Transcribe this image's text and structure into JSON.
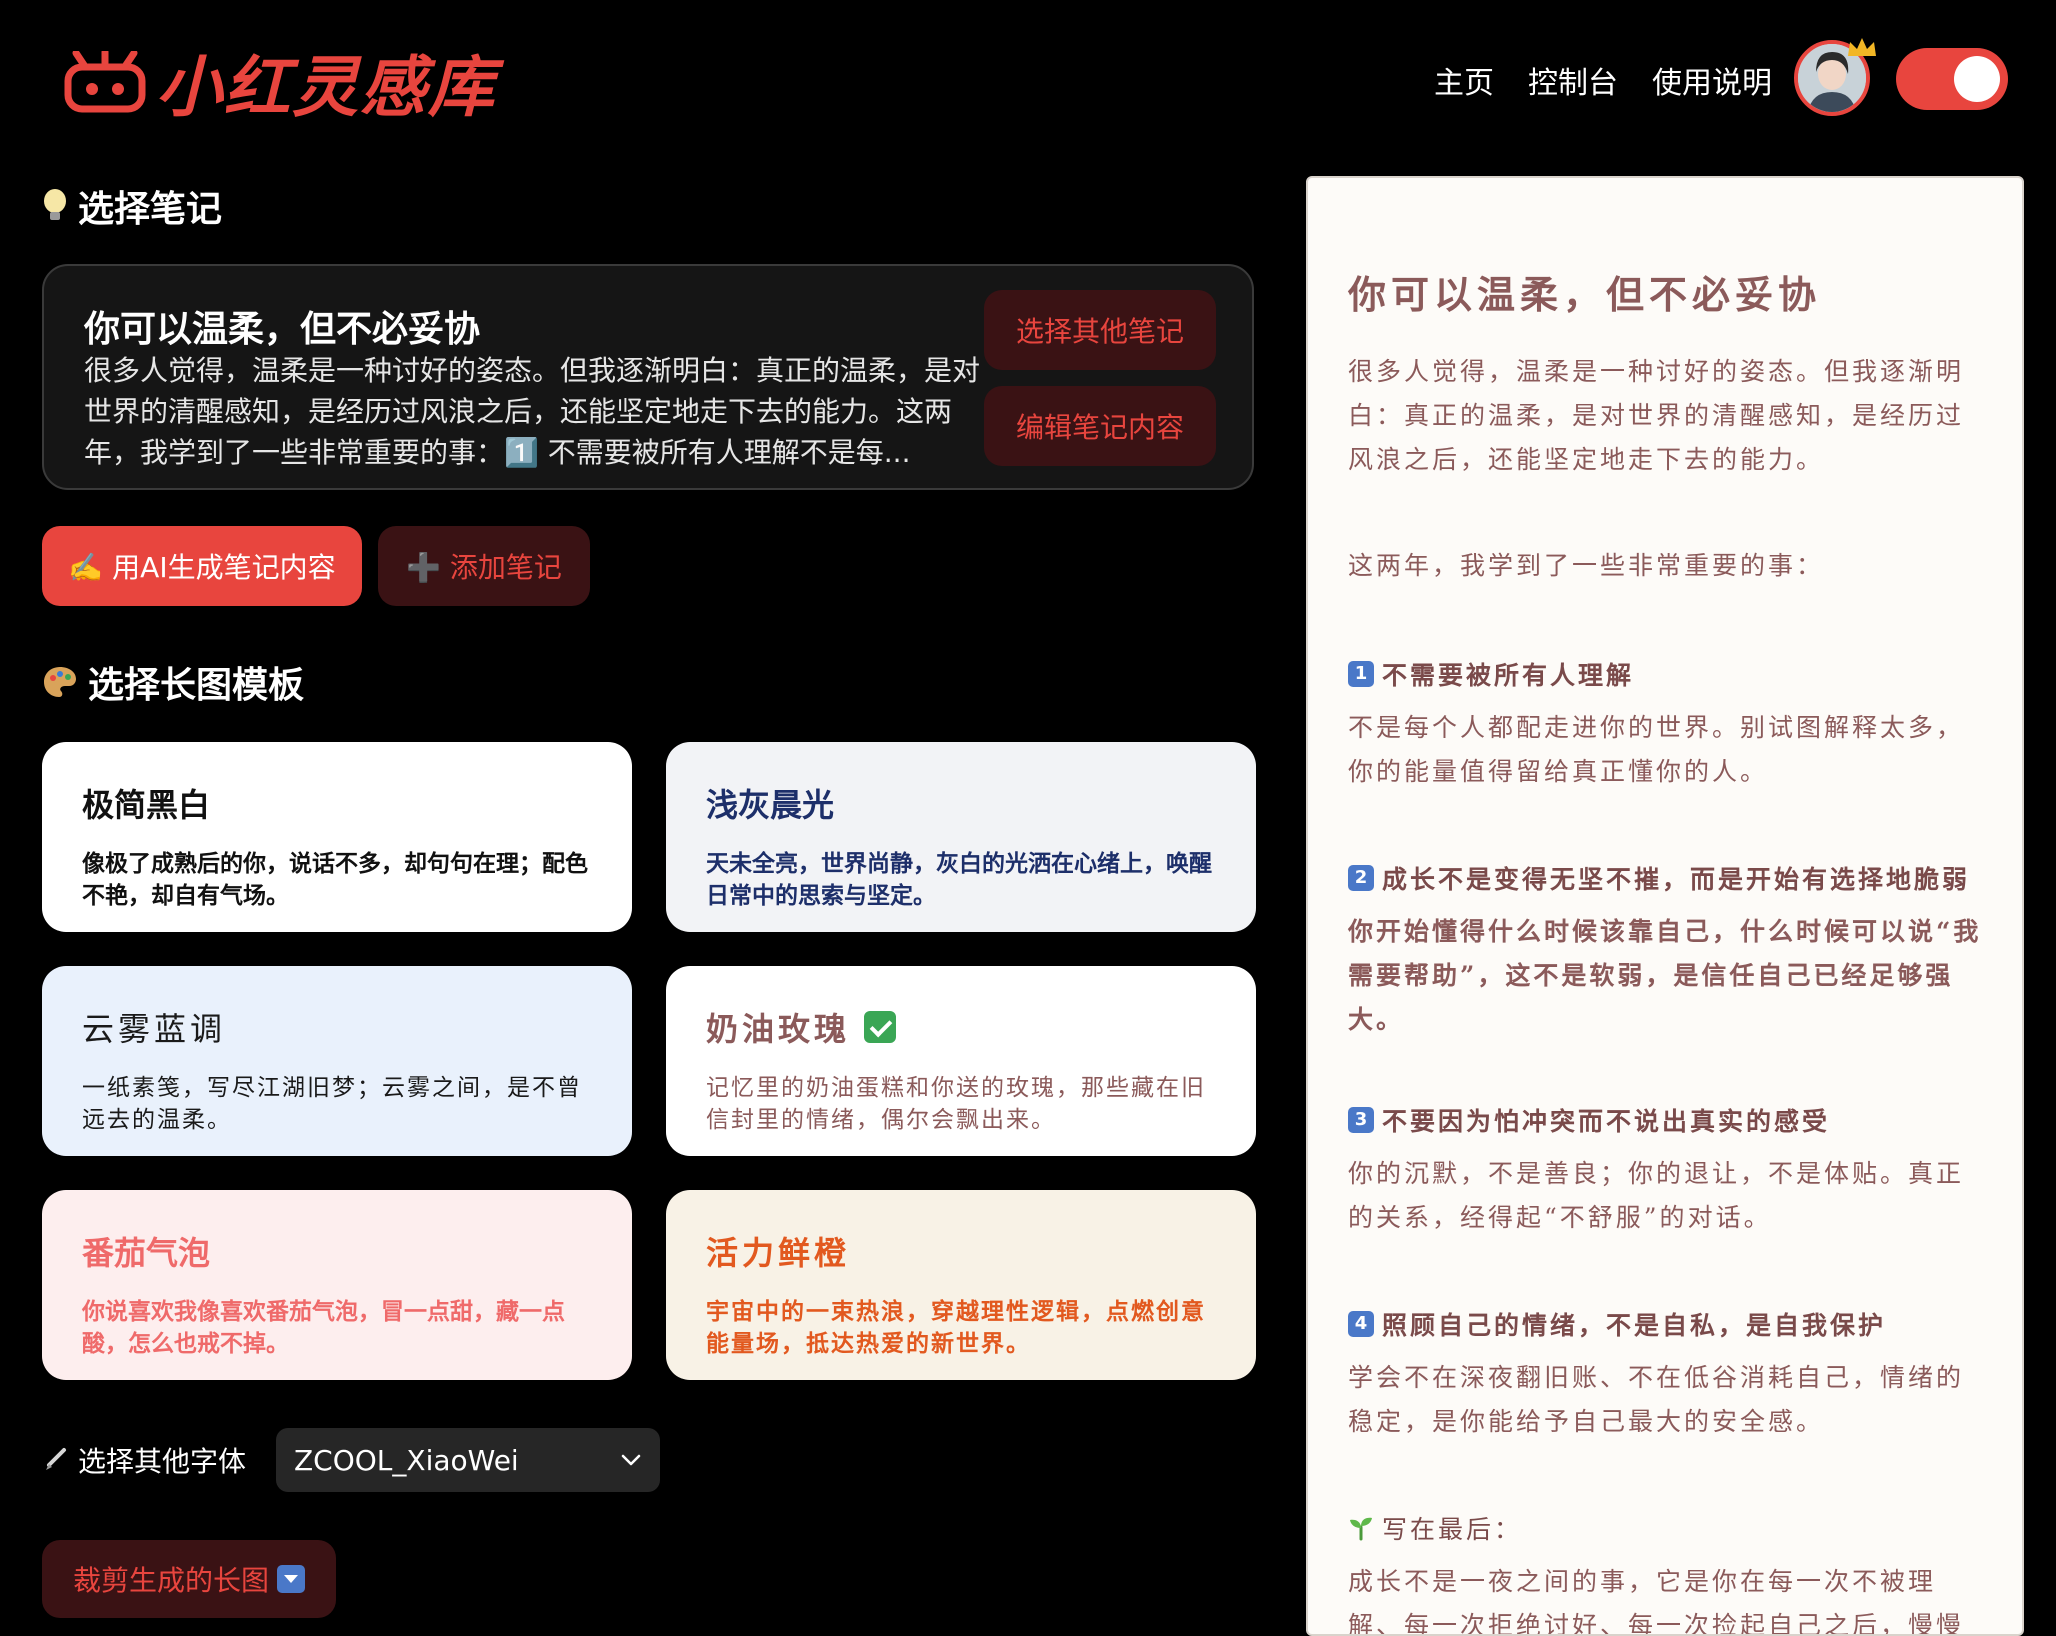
{
  "header": {
    "logo_text": "小红灵感库",
    "nav": [
      "主页",
      "控制台",
      "使用说明"
    ]
  },
  "colors": {
    "accent": "#e8453e",
    "dark_button": "#3a1214"
  },
  "select_note": {
    "section_title": "选择笔记",
    "note_title": "你可以温柔，但不必妥协",
    "note_excerpt": "很多人觉得，温柔是一种讨好的姿态。但我逐渐明白：真正的温柔，是对世界的清醒感知，是经历过风浪之后，还能坚定地走下去的能力。这两年，我学到了一些非常重要的事：1️⃣ 不需要被所有人理解不是每...",
    "choose_other_label": "选择其他笔记",
    "edit_label": "编辑笔记内容",
    "ai_generate_label": "✍️ 用AI生成笔记内容",
    "add_note_label": "➕ 添加笔记"
  },
  "templates": {
    "section_title": "选择长图模板",
    "items": [
      {
        "name": "极简黑白",
        "desc": "像极了成熟后的你，说话不多，却句句在理；配色不艳，却自有气场。"
      },
      {
        "name": "浅灰晨光",
        "desc": "天未全亮，世界尚静，灰白的光洒在心绪上，唤醒日常中的思索与坚定。"
      },
      {
        "name": "云雾蓝调",
        "desc": "一纸素笺，写尽江湖旧梦；云雾之间，是不曾远去的温柔。"
      },
      {
        "name": "奶油玫瑰",
        "desc": "记忆里的奶油蛋糕和你送的玫瑰，那些藏在旧信封里的情绪，偶尔会飘出来。"
      },
      {
        "name": "番茄气泡",
        "desc": "你说喜欢我像喜欢番茄气泡，冒一点甜，藏一点酸，怎么也戒不掉。"
      },
      {
        "name": "活力鲜橙",
        "desc": "宇宙中的一束热浪，穿越理性逻辑，点燃创意能量场，抵达热爱的新世界。"
      }
    ]
  },
  "font": {
    "label": "选择其他字体",
    "selected": "ZCOOL_XiaoWei"
  },
  "crop_label": "裁剪生成的长图",
  "preview": {
    "title": "你可以温柔，但不必妥协",
    "intro": "很多人觉得，温柔是一种讨好的姿态。但我逐渐明白：真正的温柔，是对世界的清醒感知，是经历过风浪之后，还能坚定地走下去的能力。",
    "lead": "这两年，我学到了一些非常重要的事：",
    "points": [
      {
        "num": "1",
        "heading": "不需要被所有人理解",
        "body": "不是每个人都配走进你的世界。别试图解释太多，你的能量值得留给真正懂你的人。"
      },
      {
        "num": "2",
        "heading": "成长不是变得无坚不摧，而是开始有选择地脆弱",
        "body": "你开始懂得什么时候该靠自己，什么时候可以说“我需要帮助”，这不是软弱，是信任自己已经足够强大。"
      },
      {
        "num": "3",
        "heading": "不要因为怕冲突而不说出真实的感受",
        "body": "你的沉默，不是善良；你的退让，不是体贴。真正的关系，经得起“不舒服”的对话。"
      },
      {
        "num": "4",
        "heading": "照顾自己的情绪，不是自私，是自我保护",
        "body": "学会不在深夜翻旧账、不在低谷消耗自己，情绪的稳定，是你能给予自己最大的安全感。"
      }
    ],
    "closing_heading": "写在最后：",
    "closing_body": "成长不是一夜之间的事，它是你在每一次不被理解、每一次拒绝讨好、每一次捡起自己之后，慢慢"
  }
}
